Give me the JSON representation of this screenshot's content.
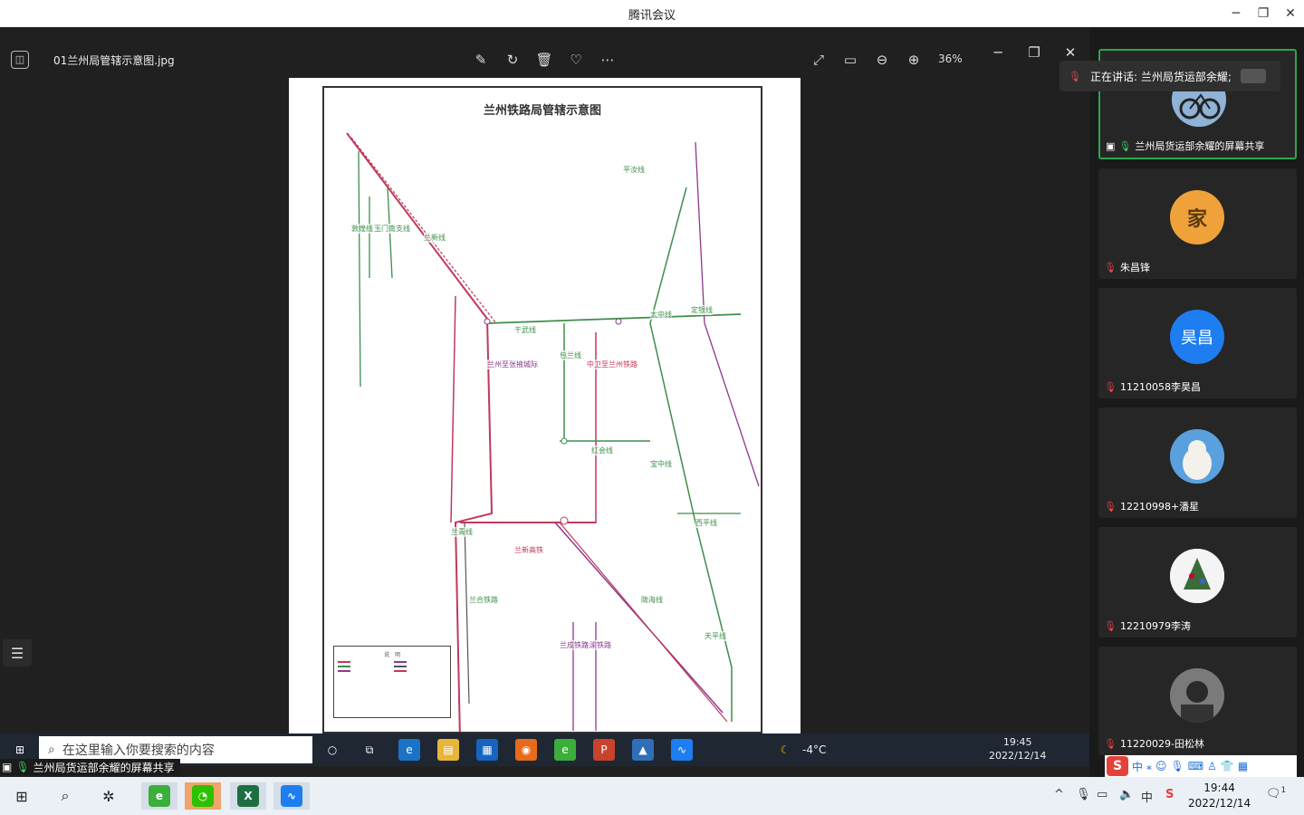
{
  "window": {
    "title": "腾讯会议"
  },
  "photo_viewer": {
    "file_name": "01兰州局管辖示意图.jpg",
    "zoom": "36%"
  },
  "map": {
    "title": "兰州铁路局管辖示意图",
    "legend_title": "说　明",
    "line_labels": [
      "干武线",
      "兰新线",
      "包兰线",
      "兰青线",
      "兰新高铁",
      "宝中线",
      "太中线",
      "西平线",
      "陇海线",
      "兰渝铁路",
      "兰成铁路",
      "兰合铁路",
      "天平线",
      "红会线",
      "平汝线",
      "定银线",
      "敦煌线",
      "中卫至兰州铁路",
      "兰州至张掖城际",
      "玉门南支线"
    ]
  },
  "inner_taskbar": {
    "search_placeholder": "在这里输入你要搜索的内容",
    "weather": "-4°C",
    "time": "19:45",
    "date": "2022/12/14"
  },
  "share_banner": {
    "label": "兰州局货运部余耀的屏幕共享"
  },
  "speaking": {
    "label": "正在讲话: 兰州局货运部余耀;"
  },
  "participants": [
    {
      "name": "兰州局货运部余耀的屏幕共享",
      "avatar_text": ""
    },
    {
      "name": "朱昌锋",
      "avatar_text": "家"
    },
    {
      "name": "11210058李昊昌",
      "avatar_text": "昊昌"
    },
    {
      "name": "12210998+潘星",
      "avatar_text": ""
    },
    {
      "name": "12210979李涛",
      "avatar_text": ""
    },
    {
      "name": "11220029-田松林",
      "avatar_text": ""
    }
  ],
  "ime": {
    "logo": "S",
    "mode": "中"
  },
  "os_taskbar": {
    "time": "19:44",
    "date": "2022/12/14",
    "ime_mode": "中",
    "notification_count": "1"
  },
  "colors": {
    "accent_blue": "#1e7df0",
    "active_green": "#2ea44f",
    "rail_red": "#c0395a",
    "rail_green": "#3e8e4a",
    "rail_purple": "#8b3a8b"
  }
}
